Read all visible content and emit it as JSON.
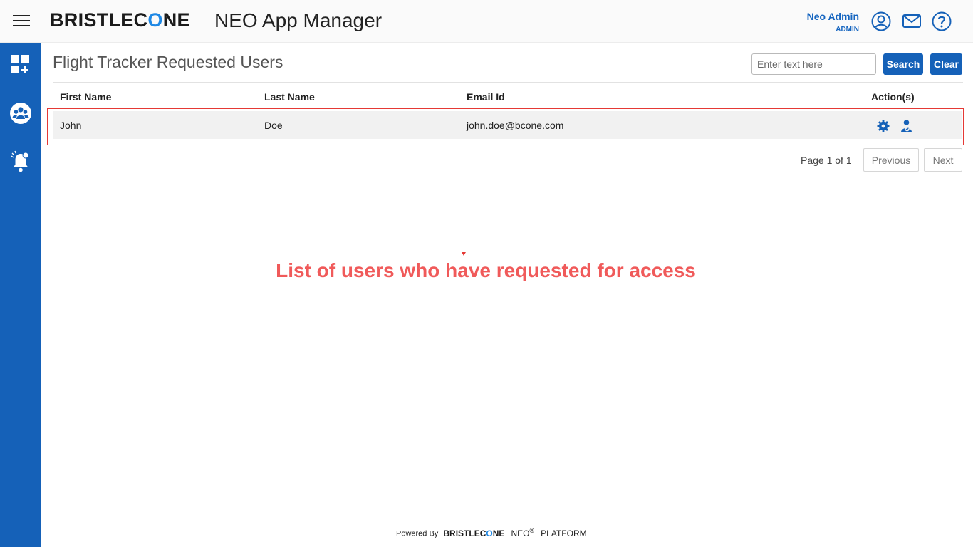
{
  "header": {
    "logo_pre": "BRISTLEC",
    "logo_accent": "O",
    "logo_post": "NE",
    "app_title": "NEO App Manager",
    "user_name": "Neo Admin",
    "user_role": "ADMIN",
    "icons": [
      "menu-icon",
      "user-circle-icon",
      "mail-icon",
      "help-icon"
    ]
  },
  "sidebar": {
    "items": [
      {
        "icon": "dashboard-add-icon"
      },
      {
        "icon": "users-group-icon"
      },
      {
        "icon": "notification-bell-icon"
      }
    ]
  },
  "main": {
    "title": "Flight Tracker Requested Users",
    "search": {
      "placeholder": "Enter text here",
      "value": ""
    },
    "search_label": "Search",
    "clear_label": "Clear",
    "table": {
      "columns": [
        "First Name",
        "Last Name",
        "Email Id",
        "Action(s)"
      ],
      "rows": [
        {
          "first_name": "John",
          "last_name": "Doe",
          "email": "john.doe@bcone.com",
          "actions": [
            "settings-gear-icon",
            "user-access-icon"
          ]
        }
      ]
    },
    "pagination": {
      "info": "Page 1 of 1",
      "previous": "Previous",
      "next": "Next"
    }
  },
  "annotation": {
    "text": "List of users who have requested for access",
    "color": "#f05a5a"
  },
  "footer": {
    "powered_by": "Powered By",
    "logo_pre": "BRISTLEC",
    "logo_accent": "O",
    "logo_post": "NE",
    "neo": "NEO",
    "reg": "®",
    "platform": "PLATFORM"
  },
  "colors": {
    "primary": "#1561b8",
    "accent": "#1e88e5",
    "highlight": "#e53935"
  }
}
